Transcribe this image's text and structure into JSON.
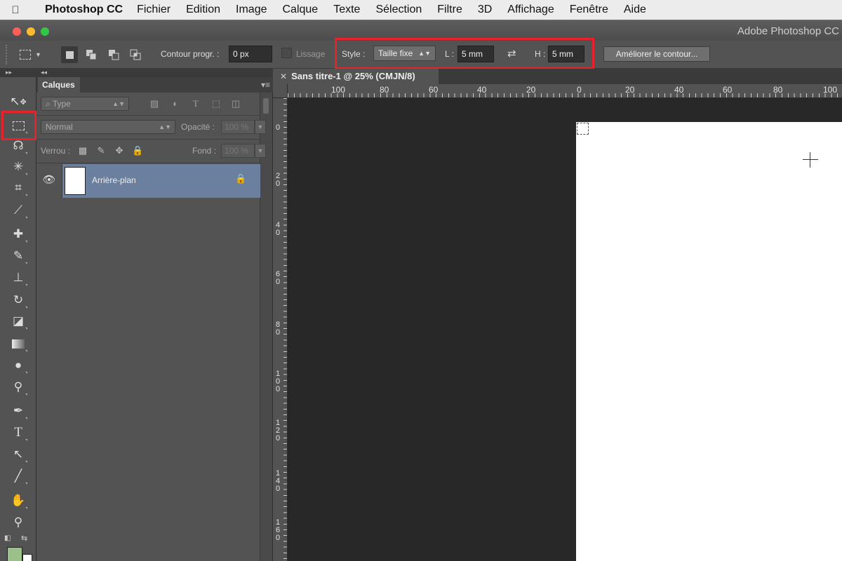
{
  "menubar": {
    "app": "Photoshop CC",
    "items": [
      "Fichier",
      "Edition",
      "Image",
      "Calque",
      "Texte",
      "Sélection",
      "Filtre",
      "3D",
      "Affichage",
      "Fenêtre",
      "Aide"
    ]
  },
  "window": {
    "title": "Adobe Photoshop CC"
  },
  "options": {
    "feather_label": "Contour progr. :",
    "feather_value": "0 px",
    "antialias_label": "Lissage",
    "style_label": "Style :",
    "style_value": "Taille fixe",
    "width_label": "L :",
    "width_value": "5 mm",
    "height_label": "H :",
    "height_value": "5 mm",
    "refine_button": "Améliorer le contour..."
  },
  "layers_panel": {
    "tab": "Calques",
    "filter_placeholder": "Type",
    "blend_mode": "Normal",
    "opacity_label": "Opacité :",
    "opacity_value": "100 %",
    "lock_label": "Verrou :",
    "fill_label": "Fond :",
    "fill_value": "100 %",
    "layers": [
      {
        "name": "Arrière-plan",
        "visible": true,
        "locked": true
      }
    ]
  },
  "document": {
    "tab_title": "Sans titre-1 @ 25% (CMJN/8)",
    "ruler_h": [
      "100",
      "80",
      "60",
      "40",
      "20",
      "0",
      "20",
      "40",
      "60",
      "80",
      "100"
    ],
    "ruler_v": [
      "0",
      "20",
      "40",
      "60",
      "80",
      "100",
      "120",
      "140",
      "160"
    ]
  },
  "colors": {
    "highlight": "#e8212b",
    "foreground_swatch": "#9bc08a",
    "background_swatch": "#ffffff",
    "layer_selected": "#6b7f9e"
  }
}
